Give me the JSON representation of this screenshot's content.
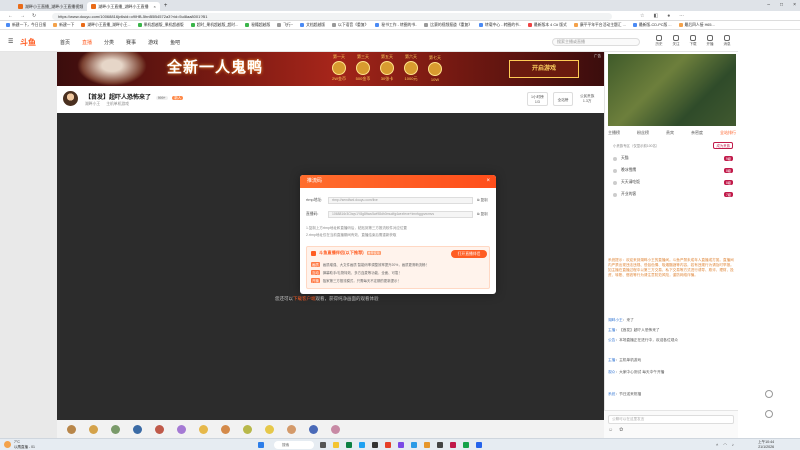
{
  "browser": {
    "tabs": [
      {
        "label": "湖畔小王直播_湖畔小王直播视频"
      },
      {
        "label": "湖畔小王直播_湖畔小王直播"
      }
    ],
    "url": "https://www.douyu.com/10068816jv6sid=o9lHB-5hnB5B4572a3?rid=5ul8aa8001?B1",
    "bookmarks": [
      "新建一下，今日日报",
      "新建一下",
      "湖畔小王直播_湖畔小王...",
      "果机超越版_果机超越版",
      "超时_果机超越版_超时...",
      "秘籍超越版",
      "飞行~",
      "文档超越版",
      "以下语音《重复》",
      "秘书工作 - 转圈的书..",
      "比赛的视频报道《重复》",
      "转载中心 - 转圈的书..",
      "最新版本 4 C# 版式",
      "康平平年平台活动主题汇 ...",
      "最新版-CD-PC版 ...",
      "最后四人接 H65..."
    ]
  },
  "site": {
    "nav": [
      "首页",
      "直播",
      "分类",
      "赛事",
      "游戏",
      "鱼吧"
    ],
    "active_nav": "直播",
    "search_placeholder": "搜索主播或直播",
    "top_icons": [
      "历史",
      "关注",
      "下载",
      "开播",
      "消息",
      "签到"
    ]
  },
  "banner": {
    "title": "全新一人鬼鸭",
    "days": [
      {
        "label": "第一天",
        "reward": "2W金币"
      },
      {
        "label": "第三天",
        "reward": "500金币"
      },
      {
        "label": "第五天",
        "reward": "30张卡"
      },
      {
        "label": "第六天",
        "reward": "1000元"
      },
      {
        "label": "第七天",
        "reward": "10W"
      }
    ],
    "cta": "开启游戏",
    "ad_label": "广告"
  },
  "room": {
    "title": "【首发】超吓人恐怖来了",
    "tag1": "999+",
    "tag2": "新人",
    "anchor": "湖畔小王",
    "meta": "主机单机游戏",
    "ranking_label": "1小时榜",
    "ranking_value": "1/3",
    "follow": "全站榜",
    "fans": "公民贵族",
    "fans_value": "1.3万"
  },
  "player": {
    "hint_prefix": "您还可以",
    "hint_link": "下载客户端",
    "hint_suffix": "观看，获得纯净画面的观看体验"
  },
  "modal": {
    "title": "推流码",
    "close": "×",
    "rtmp_label": "rtmp地址:",
    "rtmp_value": "rtmp://sendfwd.douyu.com/live",
    "key_label": "直播码:",
    "key_value": "1068816r3Cbqv1Y8g8ftwu5wi98dh0mudfg4wrzfexe+lmnfqgpvwmvs",
    "copy": "复制",
    "note1": "1.复制上方rtmp地址和直播码后，粘贴到第三方推流软件对应位置",
    "note2": "2.rtmp地址仅在当前直播期间有效，直播结束后需重新获取",
    "promo_title": "斗鱼直播伴侣(以下推荐)",
    "promo_tag": "推荐使用",
    "promo_btn": "打开直播伴侣",
    "lines": [
      {
        "label": "画质",
        "text": "画质增强、大文件画质 智能码率调整效率提升20%，画质更清晰流畅！"
      },
      {
        "label": "互动",
        "text": "弹幕助手/礼物特效、多方连麦等功能，全面、可靠！"
      },
      {
        "label": "开播",
        "text": "独家第三方推流模式，只需每天不定期的更新提示！"
      }
    ]
  },
  "sidebar": {
    "tabs": [
      "主播榜",
      "粉丝榜",
      "贵宾",
      "亲密度",
      "全站排行"
    ],
    "active_tab": "全站排行",
    "rank_header": "小贵族专区（仅显示前100名）",
    "rank_header_tag": "成为贵族",
    "ranks": [
      {
        "name": "天猫",
        "badge": "9级"
      },
      {
        "name": "晚冰雪鹰",
        "badge": "8级"
      },
      {
        "name": "天天请吃饭",
        "badge": "8级"
      },
      {
        "name": "开业的客",
        "badge": "7级"
      }
    ],
    "notice": "系统提示：欢迎来到湖畔小王的直播间。斗鱼严禁未成年人直播或打赏。直播间内严禁出现违法违规、低俗色情、吸烟酗酒等内容，若有违规行为请及时举报。如主播在直播过程中以第三方交易、私下交易等方式进行诱导、欺诈、理财、投资、转账、借钱等行为请注意防范风险，谨防网络诈骗。",
    "chats": [
      {
        "user": "湖畔小王",
        "text": "来了"
      },
      {
        "user": "主播",
        "text": "【首发】超吓人恐怖来了"
      },
      {
        "user": "公告",
        "text": "本场直播正在进行中，欢迎各位观众"
      },
      {
        "user": "主播",
        "text": "主机单机游戏"
      },
      {
        "user": "观众",
        "text": "大家中心测试 每天中午开播"
      },
      {
        "user": "系统",
        "text": "节日送来祝福"
      }
    ],
    "input_placeholder": "公聊可以在这里发言"
  },
  "taskbar": {
    "search": "搜索",
    "time": "上午10:44",
    "date": "21/1/2026",
    "weather_temp": "7°C",
    "weather_text": "以鹰直播 - 01"
  }
}
